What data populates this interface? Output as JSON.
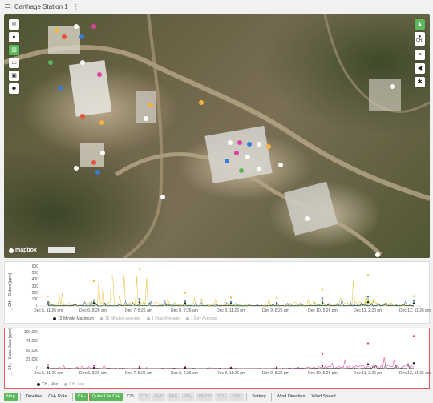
{
  "header": {
    "title": "Carthage Station 1",
    "menu_icon": "hamburger-icon",
    "more_icon": "kebab-icon"
  },
  "map": {
    "left_controls": [
      "compass-icon",
      "target-icon",
      "chart-icon",
      "car-icon",
      "bus-icon",
      "layers-icon"
    ],
    "right_controls": [
      "drop-icon",
      "ch4-label-icon",
      "list-icon",
      "megaphone-icon",
      "fan-icon"
    ],
    "right_control_label": "CH₄",
    "attribution": "mapbox"
  },
  "chart1": {
    "ylabel": "CH₄ - Cubes [ppm]",
    "yticks": [
      "600",
      "500",
      "400",
      "300",
      "200",
      "100",
      "0"
    ],
    "xticks": [
      "Dec 5, 11:26 am",
      "Dec 6, 8:26 am",
      "Dec 7, 5:26 am",
      "Dec 8, 2:26 am",
      "Dec 8, 11:26 pm",
      "Dec 9, 8:26 pm",
      "Dec 10, 5:26 pm",
      "Dec 11, 2:26 pm",
      "Dec 12, 11:26 am"
    ],
    "legend": [
      "15 Minute Maximum",
      "15 Minutes Average",
      "1 Hour Average",
      "1 Day Average"
    ]
  },
  "chart2": {
    "ylabel": "CH₄ - Qube Jaws [ppm]",
    "yticks": [
      "100,000",
      "75,000",
      "50,000",
      "25,000",
      "0"
    ],
    "xticks": [
      "Dec 5, 11:26 am",
      "Dec 6, 8:26 am",
      "Dec 7, 5:26 am",
      "Dec 8, 2:26 am",
      "Dec 8, 11:26 pm",
      "Dec 9, 8:26 pm",
      "Dec 10, 5:26 pm",
      "Dec 11, 2:26 pm",
      "Dec 12, 11:26 am"
    ],
    "legend": [
      "CH₄ Max",
      "CH₄ Avg"
    ]
  },
  "chart_data": [
    {
      "type": "line",
      "ylabel": "CH₄ - Cubes [ppm]",
      "ylim": [
        0,
        600
      ],
      "x": [
        "Dec 5, 11:26 am",
        "Dec 6, 8:26 am",
        "Dec 7, 5:26 am",
        "Dec 8, 2:26 am",
        "Dec 8, 11:26 pm",
        "Dec 9, 8:26 pm",
        "Dec 10, 5:26 pm",
        "Dec 11, 2:26 pm",
        "Dec 12, 11:26 am"
      ],
      "series": [
        {
          "name": "15 Minute Maximum",
          "values": [
            150,
            380,
            560,
            200,
            130,
            120,
            250,
            470,
            150
          ]
        },
        {
          "name": "15 Minutes Average",
          "values": [
            60,
            90,
            110,
            70,
            60,
            50,
            120,
            140,
            80
          ]
        },
        {
          "name": "1 Hour Average",
          "values": [
            40,
            60,
            80,
            50,
            40,
            35,
            80,
            100,
            50
          ]
        },
        {
          "name": "1 Day Average",
          "values": [
            30,
            45,
            55,
            40,
            35,
            30,
            50,
            60,
            40
          ]
        }
      ]
    },
    {
      "type": "line",
      "ylabel": "CH₄ - Qube Jaws [ppm]",
      "ylim": [
        0,
        100000
      ],
      "x": [
        "Dec 5, 11:26 am",
        "Dec 6, 8:26 am",
        "Dec 7, 5:26 am",
        "Dec 8, 2:26 am",
        "Dec 8, 11:26 pm",
        "Dec 9, 8:26 pm",
        "Dec 10, 5:26 pm",
        "Dec 11, 2:26 pm",
        "Dec 12, 11:26 am"
      ],
      "series": [
        {
          "name": "CH₄ Max",
          "values": [
            10000,
            8000,
            5000,
            4000,
            3000,
            3000,
            40000,
            70000,
            90000
          ]
        },
        {
          "name": "CH₄ Avg",
          "values": [
            3000,
            2000,
            1500,
            1500,
            1000,
            1000,
            8000,
            12000,
            15000
          ]
        }
      ]
    }
  ],
  "bottom_tabs": [
    {
      "label": "Map",
      "state": "active"
    },
    {
      "label": "Timeline",
      "state": "normal"
    },
    {
      "label": "CH₄ Rate",
      "state": "normal"
    },
    {
      "label": "CH₄",
      "state": "active"
    },
    {
      "label": "Qube Lite CH₄",
      "state": "highlight"
    },
    {
      "label": "CO",
      "state": "normal"
    },
    {
      "label": "CO₂",
      "state": "disabled"
    },
    {
      "label": "H₂S",
      "state": "disabled"
    },
    {
      "label": "NH₃",
      "state": "disabled"
    },
    {
      "label": "NO₂",
      "state": "disabled"
    },
    {
      "label": "PM2.5",
      "state": "disabled"
    },
    {
      "label": "SO₂",
      "state": "disabled"
    },
    {
      "label": "VOC",
      "state": "disabled"
    },
    {
      "label": "Battery",
      "state": "normal"
    },
    {
      "label": "Wind Direction",
      "state": "normal"
    },
    {
      "label": "Wind Speed",
      "state": "normal"
    }
  ],
  "colors": {
    "accent": "#5cb85c",
    "highlight": "#e45b5b",
    "yellow": "#e8c23a",
    "blue": "#3a7bd5",
    "pink": "#e040a0",
    "dark": "#222222"
  }
}
